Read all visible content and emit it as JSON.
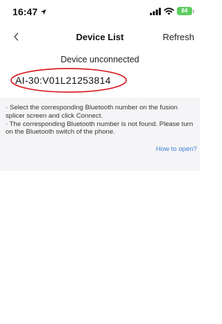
{
  "status_bar": {
    "time": "16:47",
    "battery": "84",
    "battery_color": "#5ccd5f"
  },
  "nav": {
    "back_icon": "chevron-left-icon",
    "title": "Device List",
    "refresh_label": "Refresh"
  },
  "connection_status": "Device unconnected",
  "devices": [
    {
      "name": "AI-30:V01L21253814",
      "highlighted": true,
      "highlight_color": "#d81f26"
    }
  ],
  "info": {
    "lines": [
      "· Select the corresponding Bluetooth number on the fusion splicer screen and click Connect.",
      "· The corresponding Bluetooth number is not found. Please turn on the Bluetooth switch of the phone."
    ],
    "help_link": "How to open?",
    "link_color": "#3d7ed9",
    "background": "#f5f5f7"
  }
}
